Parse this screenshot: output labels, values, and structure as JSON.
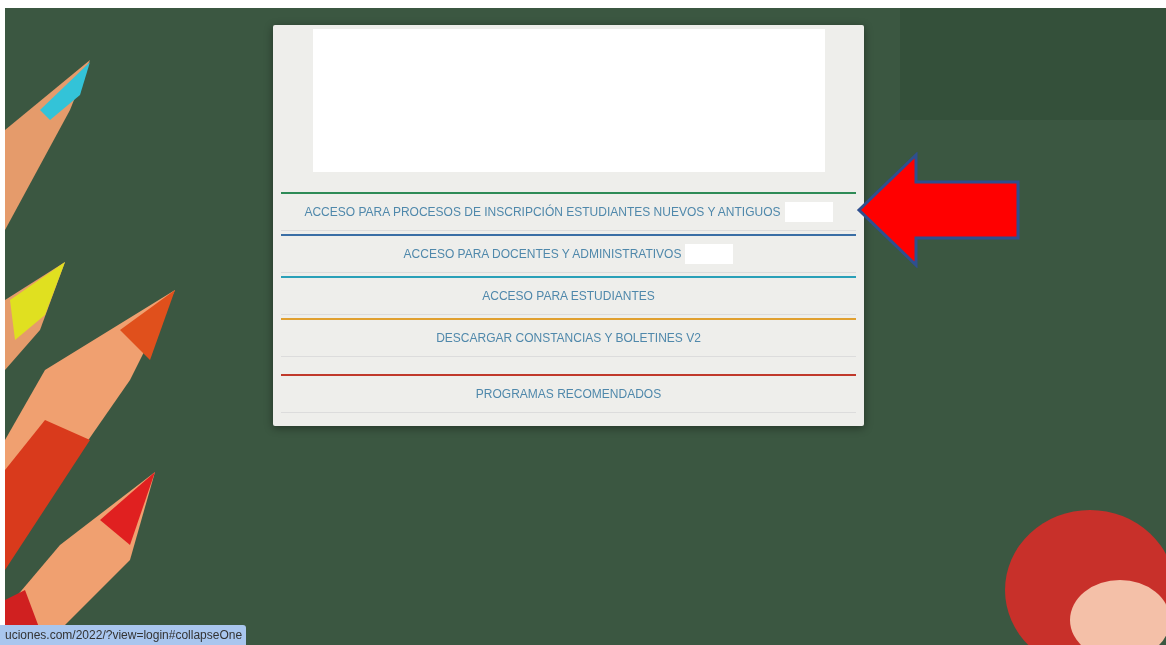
{
  "menu": {
    "items": [
      {
        "label": "ACCESO PARA PROCESOS DE INSCRIPCIÓN ESTUDIANTES NUEVOS Y ANTIGUOS",
        "color": "#2e8b57",
        "masked": true
      },
      {
        "label": "ACCESO PARA DOCENTES Y ADMINISTRATIVOS",
        "color": "#3a6ea5",
        "masked": true
      },
      {
        "label": "ACCESO PARA ESTUDIANTES",
        "color": "#2aa0b8",
        "masked": false
      },
      {
        "label": "DESCARGAR CONSTANCIAS Y BOLETINES V2",
        "color": "#e0a030",
        "masked": false
      },
      {
        "label": "PROGRAMAS RECOMENDADOS",
        "color": "#c0392b",
        "masked": false
      }
    ]
  },
  "status_bar": {
    "url": "uciones.com/2022/?view=login#collapseOne"
  }
}
